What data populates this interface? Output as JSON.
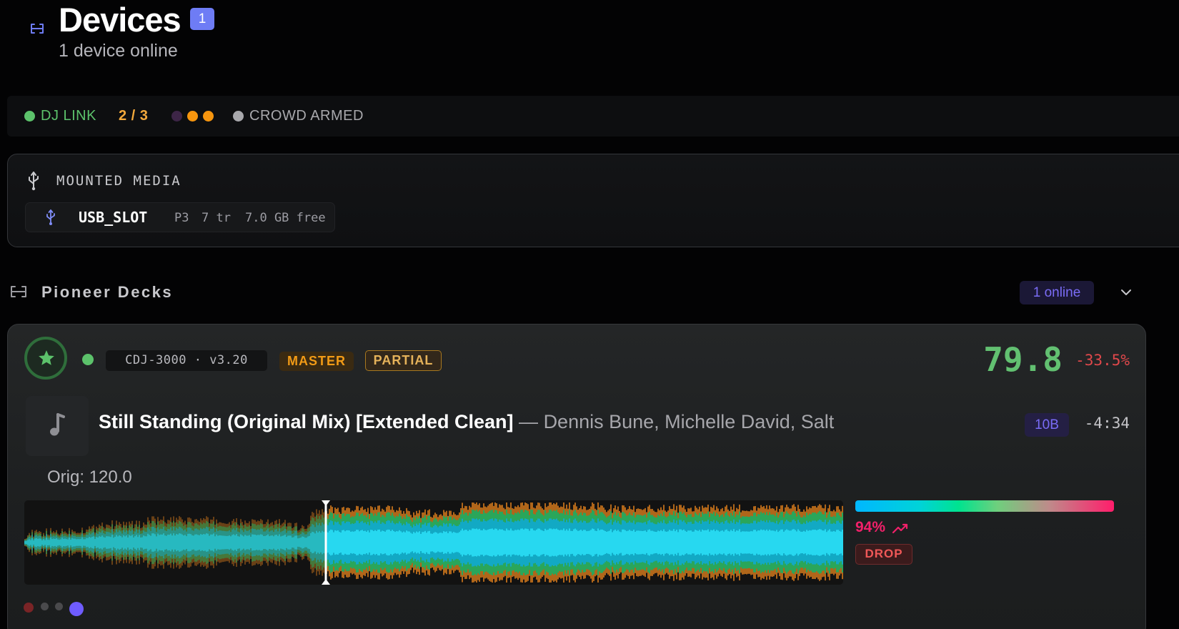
{
  "header": {
    "title": "Devices",
    "badge": "1",
    "subtitle": "1 device online"
  },
  "statusbar": {
    "link_label": "DJ LINK",
    "link_color": "#5cc26b",
    "count": "2 / 3",
    "count_color": "#f3a93c",
    "indicator_colors": [
      "#3d2547",
      "#f6950e",
      "#f6950e"
    ],
    "crowd_label": "CROWD ARMED",
    "crowd_color": "#a8a8ac"
  },
  "media": {
    "title": "MOUNTED MEDIA",
    "chip": {
      "name": "USB_SLOT",
      "player": "P3",
      "tracks": "7 tr",
      "free": "7.0 GB free"
    }
  },
  "section": {
    "title": "Pioneer Decks",
    "online": "1 online"
  },
  "deck": {
    "model": "CDJ-3000  ·  v3.20",
    "master_tag": "MASTER",
    "partial_tag": "PARTIAL",
    "bpm": "79.8",
    "pitch": "-33.5%",
    "track_title": "Still Standing (Original Mix) [Extended Clean]",
    "separator": " — ",
    "track_artist": "Dennis Bune, Michelle David, Salt",
    "key": "10B",
    "time_left": "-4:34",
    "orig_bpm": "Orig: 120.0",
    "playhead_position": 0.368,
    "energy_pct": "94%",
    "energy_level": 0.94,
    "drop_tag": "DROP",
    "leds": [
      "#7a2426",
      "#4a4a4c",
      "#4a4a4c",
      "#6f5cff"
    ]
  },
  "colors": {
    "accent": "#6e7cf5",
    "purple": "#7a6cf6",
    "master": "#f29b16",
    "bpm": "#62c071",
    "negative": "#e0484b",
    "energy": "#f2206a"
  }
}
